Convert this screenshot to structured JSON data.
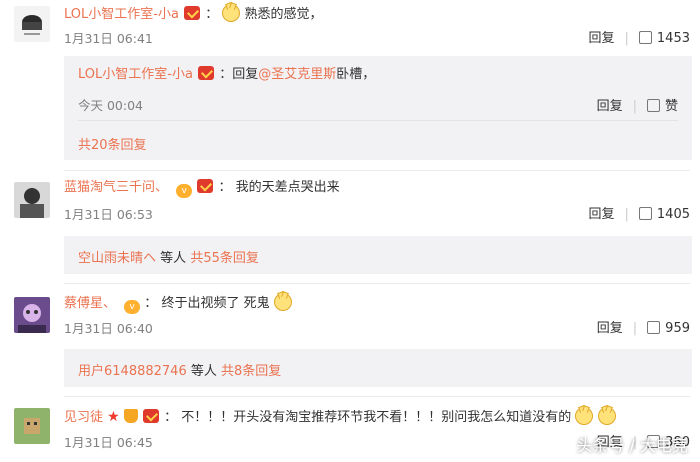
{
  "comments": [
    {
      "username": "LOL小智工作室-小a",
      "colon": "：",
      "text": "熟悉的感觉，",
      "time": "1月31日 06:41",
      "reply_label": "回复",
      "likes": "1453",
      "sub_reply": {
        "username": "LOL小智工作室-小a",
        "prefix": "：回复",
        "mention": "@圣艾克里斯",
        "text": "卧槽，",
        "time": "今天 00:04",
        "reply_label": "回复",
        "like_label": "赞"
      },
      "more_replies": "共20条回复"
    },
    {
      "username": "蓝猫淘气三千问、",
      "colon": "：",
      "text": "我的天差点哭出来",
      "time": "1月31日 06:53",
      "reply_label": "回复",
      "likes": "1405",
      "replier": "空山雨未晴ヘ",
      "replier_suffix": "等人",
      "more_replies": "共55条回复"
    },
    {
      "username": "蔡傅星、",
      "colon": "：",
      "text": "终于出视频了 死鬼",
      "time": "1月31日 06:40",
      "reply_label": "回复",
      "likes": "959",
      "replier": "用户6148882746",
      "replier_suffix": "等人",
      "more_replies": "共8条回复"
    },
    {
      "username": "见习徒",
      "colon": "：",
      "text": "不！！！开头没有淘宝推荐环节我不看！！！别问我怎么知道没有的",
      "time": "1月31日 06:45",
      "reply_label": "回复",
      "likes": "380"
    }
  ],
  "watermark": "头条号 / 大电竞",
  "colors": {
    "username": "#eb7350",
    "reply_bg": "#f2f2f5",
    "text": "#333333",
    "muted": "#808080"
  }
}
